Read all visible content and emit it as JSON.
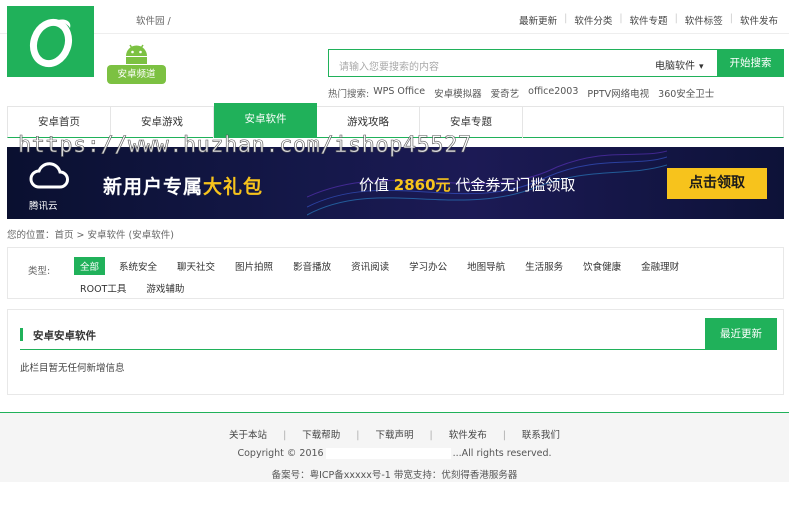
{
  "topbar": {
    "crumb": "软件园 /",
    "links": [
      "最新更新",
      "软件分类",
      "软件专题",
      "软件标签",
      "软件发布"
    ]
  },
  "android_badge": "安卓频道",
  "search": {
    "placeholder": "请输入您要搜索的内容",
    "selected": "电脑软件",
    "button": "开始搜索"
  },
  "hot": {
    "label": "热门搜索:",
    "items": [
      "WPS Office",
      "安卓模拟器",
      "爱奇艺",
      "office2003",
      "PPTV网络电视",
      "360安全卫士"
    ]
  },
  "nav": {
    "tabs": [
      "安卓首页",
      "安卓游戏",
      "安卓软件",
      "游戏攻略",
      "安卓专题"
    ],
    "active_index": 2
  },
  "banner": {
    "brand": "腾讯云",
    "headline_prefix": "新用户专属",
    "headline_gift": "大礼包",
    "offer_prefix": "价值",
    "offer_amount": "2860元",
    "offer_suffix": "代金券无门槛领取",
    "cta": "点击领取"
  },
  "watermark": "https://www.huzhan.com/ishop45527",
  "location": "您的位置：首页 > 安卓软件 (安卓软件)",
  "categories": {
    "label": "类型:",
    "row1": [
      "全部",
      "系统安全",
      "聊天社交",
      "图片拍照",
      "影音播放",
      "资讯阅读",
      "学习办公",
      "地图导航",
      "生活服务",
      "饮食健康",
      "金融理财"
    ],
    "row2": [
      "ROOT工具",
      "游戏辅助"
    ],
    "active": "全部"
  },
  "content": {
    "title": "安卓安卓软件",
    "button": "最近更新",
    "empty": "此栏目暂无任何新增信息"
  },
  "footer": {
    "links": [
      "关于本站",
      "下载帮助",
      "下载声明",
      "软件发布",
      "联系我们"
    ],
    "copy_prefix": "Copyright © 2016",
    "copy_suffix": "...All rights reserved.",
    "icp": "备案号：粤ICP备xxxxx号-1   带宽支持：优刻得香港服务器"
  },
  "colors": {
    "accent": "#20b15a",
    "banner_gold": "#f7c31c",
    "android_green": "#7cc142"
  }
}
